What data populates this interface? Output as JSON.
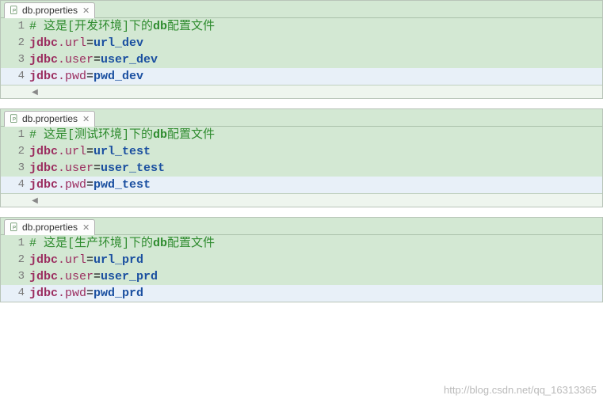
{
  "watermark": "http://blog.csdn.net/qq_16313365",
  "editors": [
    {
      "tab_label": "db.properties",
      "lines": [
        {
          "num": "1",
          "kind": "comment",
          "text": "# 这是[开发环境]下的db配置文件",
          "current": false
        },
        {
          "num": "2",
          "kind": "prop",
          "key": "jdbc.url",
          "value": "url_dev",
          "current": false
        },
        {
          "num": "3",
          "kind": "prop",
          "key": "jdbc.user",
          "value": "user_dev",
          "current": false
        },
        {
          "num": "4",
          "kind": "prop",
          "key": "jdbc.pwd",
          "value": "pwd_dev",
          "current": true
        }
      ]
    },
    {
      "tab_label": "db.properties",
      "lines": [
        {
          "num": "1",
          "kind": "comment",
          "text": "# 这是[测试环境]下的db配置文件",
          "current": false
        },
        {
          "num": "2",
          "kind": "prop",
          "key": "jdbc.url",
          "value": "url_test",
          "current": false
        },
        {
          "num": "3",
          "kind": "prop",
          "key": "jdbc.user",
          "value": "user_test",
          "current": false
        },
        {
          "num": "4",
          "kind": "prop",
          "key": "jdbc.pwd",
          "value": "pwd_test",
          "current": true
        }
      ]
    },
    {
      "tab_label": "db.properties",
      "lines": [
        {
          "num": "1",
          "kind": "comment",
          "text": "# 这是[生产环境]下的db配置文件",
          "current": false
        },
        {
          "num": "2",
          "kind": "prop",
          "key": "jdbc.url",
          "value": "url_prd",
          "current": false
        },
        {
          "num": "3",
          "kind": "prop",
          "key": "jdbc.user",
          "value": "user_prd",
          "current": false
        },
        {
          "num": "4",
          "kind": "prop",
          "key": "jdbc.pwd",
          "value": "pwd_prd",
          "current": true
        }
      ]
    }
  ]
}
